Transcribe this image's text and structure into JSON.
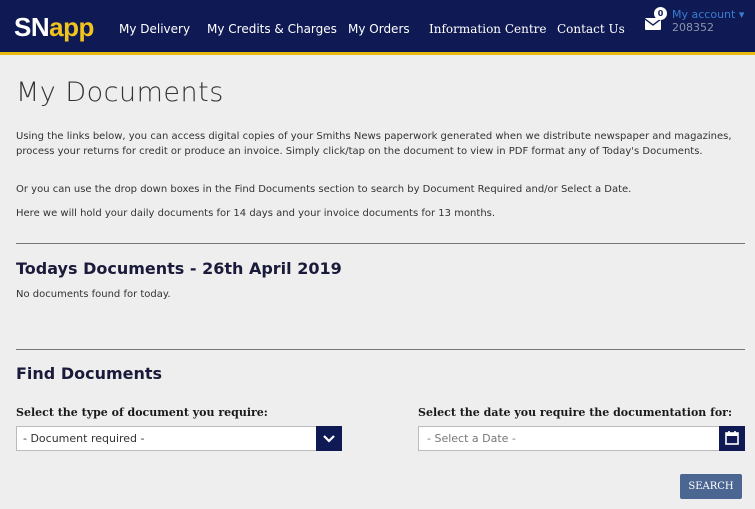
{
  "brand": {
    "logo_sn": "SN",
    "logo_app": "app"
  },
  "nav": {
    "items": [
      "My Delivery",
      "My Credits & Charges",
      "My Orders",
      "Information Centre",
      "Contact Us"
    ],
    "notification_count": "0",
    "account_label": "My account",
    "account_number": "208352"
  },
  "page": {
    "title": "My Documents",
    "intro": [
      "Using the links below, you can access digital copies of your Smiths News paperwork generated when we distribute newspaper and magazines, process your returns for credit or produce an invoice. Simply click/tap on the document to view in PDF format any of Today's Documents.",
      "Or you can use the drop down boxes in the Find Documents section to search by Document Required and/or Select a Date.",
      "Here we will hold your daily documents for 14 days and your invoice documents for 13 months."
    ]
  },
  "today": {
    "heading": "Todays Documents - 26th April 2019",
    "empty_message": "No documents found for today."
  },
  "find": {
    "heading": "Find Documents",
    "type_label": "Select the type of document you require:",
    "type_value": "- Document required -",
    "date_label": "Select the date you require the documentation for:",
    "date_placeholder": "- Select a Date -",
    "search_label": "SEARCH"
  },
  "colors": {
    "navbar": "#0f1a54",
    "accent": "#f2c31d",
    "button": "#4b6691"
  },
  "icons": [
    "envelope-icon",
    "chevron-down-icon",
    "calendar-icon",
    "caret-down-icon"
  ]
}
